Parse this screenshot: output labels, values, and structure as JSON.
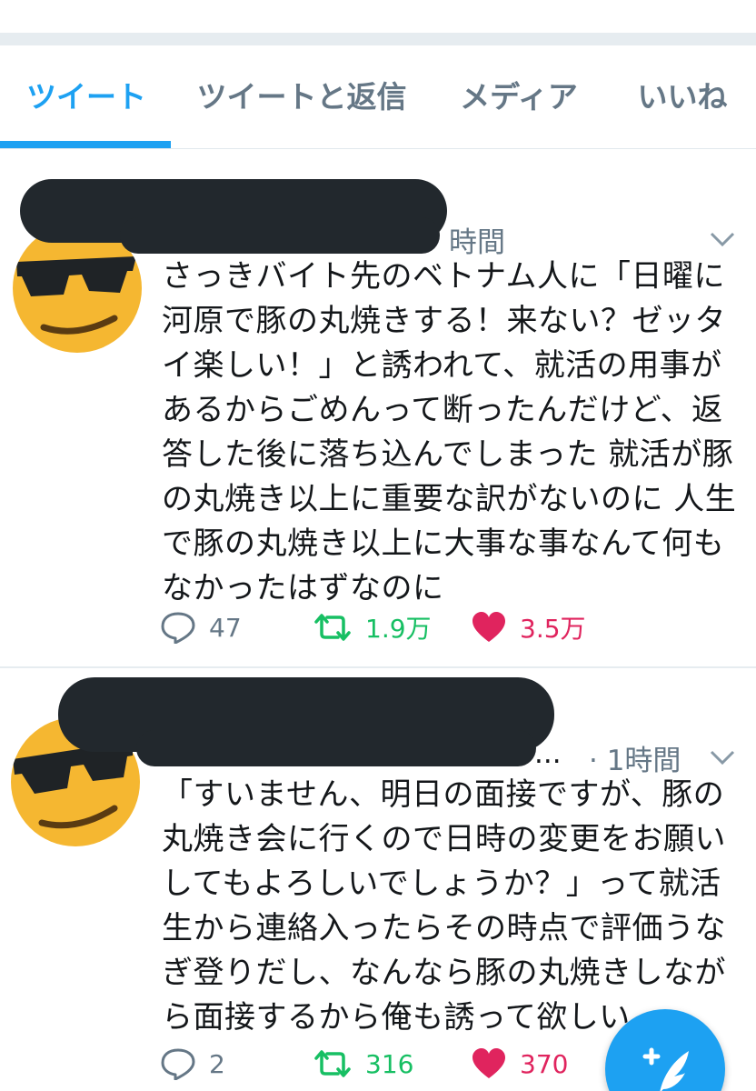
{
  "tabs": [
    {
      "label": "ツイート",
      "active": true
    },
    {
      "label": "ツイートと返信",
      "active": false
    },
    {
      "label": "メディア",
      "active": false
    },
    {
      "label": "いいね",
      "active": false
    }
  ],
  "tweets": [
    {
      "time": "時間",
      "text": "さっきバイト先のベトナム人に「日曜に\n河原で豚の丸焼きする！来ない？ゼッタ\nイ楽しい！」と誘われて、就活の用事が\nあるからごめんって断ったんだけど、返\n答した後に落ち込んでしまった 就活が豚\nの丸焼き以上に重要な訳がないのに 人生\nで豚の丸焼き以上に大事な事なんて何も\nなかったはずなのに",
      "replies": "47",
      "retweets": "1.9万",
      "likes": "3.5万"
    },
    {
      "handle_suffix": "...",
      "time": "· 1時間",
      "text": "「すいません、明日の面接ですが、豚の\n丸焼き会に行くので日時の変更をお願い\nしてもよろしいでしょうか？」って就活\n生から連絡入ったらその時点で評価うな\nぎ登りだし、なんなら豚の丸焼きしなが\nら面接するから俺も誘って欲しい。",
      "replies": "2",
      "retweets": "316",
      "likes": "370"
    }
  ],
  "icons": {
    "reply": "reply-icon",
    "retweet": "retweet-icon",
    "like": "heart-icon",
    "more": "chevron-down-icon",
    "compose": "compose-tweet-icon",
    "avatar": "sunglasses-emoji-avatar"
  },
  "colors": {
    "accent": "#1da1f2",
    "retweet": "#17bf63",
    "like": "#e0245e",
    "secondary_text": "#657786",
    "avatar": "#f5b731"
  }
}
